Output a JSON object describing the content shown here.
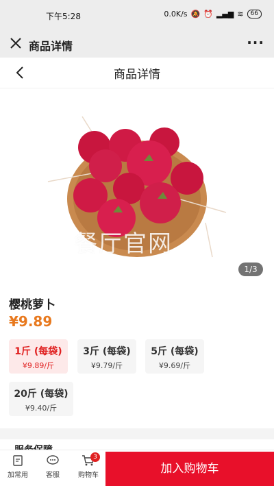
{
  "status_bar": {
    "time": "下午5:28",
    "net_speed": "0.0K/s",
    "battery": "66"
  },
  "mini_program": {
    "title": "商品详情"
  },
  "nav": {
    "title": "商品详情"
  },
  "gallery": {
    "watermark": "餐厅官网",
    "counter": "1/3"
  },
  "product": {
    "name": "樱桃萝卜",
    "price": "¥9.89",
    "specs": [
      {
        "weight": "1斤 (每袋)",
        "unit_price": "¥9.89/斤",
        "selected": true
      },
      {
        "weight": "3斤 (每袋)",
        "unit_price": "¥9.79/斤",
        "selected": false
      },
      {
        "weight": "5斤 (每袋)",
        "unit_price": "¥9.69/斤",
        "selected": false
      },
      {
        "weight": "20斤 (每袋)",
        "unit_price": "¥9.40/斤",
        "selected": false
      }
    ]
  },
  "service_title": "服务保障",
  "bottom_bar": {
    "tabs": [
      {
        "label": "加常用",
        "icon": "note-add-icon"
      },
      {
        "label": "客服",
        "icon": "chat-icon"
      },
      {
        "label": "购物车",
        "icon": "cart-icon"
      }
    ],
    "cart_count": "3",
    "add_to_cart": "加入购物车"
  },
  "colors": {
    "accent": "#e8102a",
    "price": "#e8791e"
  }
}
